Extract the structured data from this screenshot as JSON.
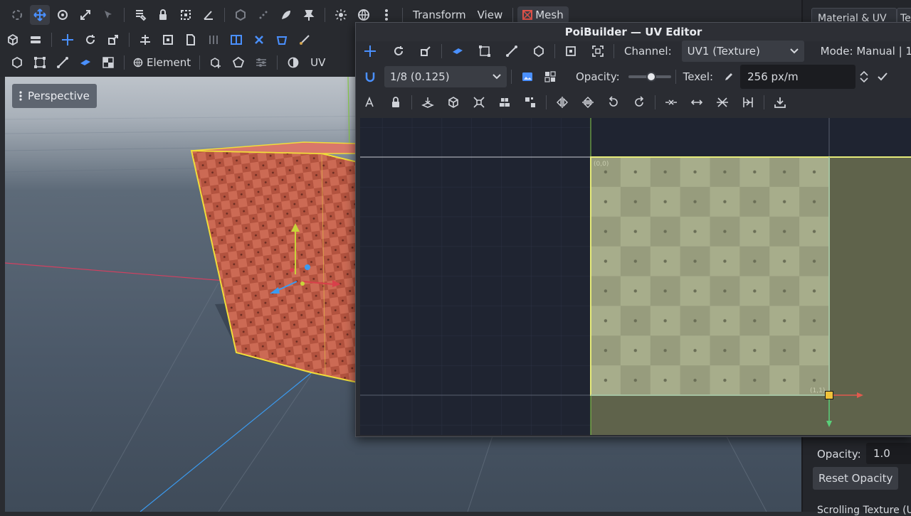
{
  "menus": {
    "transform": "Transform",
    "view": "View",
    "mesh": "Mesh"
  },
  "select_mode": {
    "element": "Element",
    "uv": "UV"
  },
  "viewport": {
    "perspective_label": "Perspective"
  },
  "right_panel": {
    "tabs": [
      "Material & UV",
      "Tex"
    ],
    "opacity_label": "Opacity:",
    "opacity_value": "1.0",
    "reset_opacity": "Reset Opacity",
    "scrolling_label": "Scrolling Texture (U"
  },
  "uv_editor": {
    "title": "PoiBuilder — UV Editor",
    "channel_label": "Channel:",
    "channel_value": "UV1 (Texture)",
    "mode_label": "Mode: Manual | 1",
    "grid_value": "1/8 (0.125)",
    "opacity_label": "Opacity:",
    "opacity_fraction": 0.55,
    "texel_label": "Texel:",
    "texel_value": "256 px/m",
    "corner_top_left": "(0,0)",
    "corner_bottom_right": "(1,1)"
  },
  "colors": {
    "accent": "#3c8cff",
    "uv_square": "#a8b08e",
    "uv_border": "#e6eb7a",
    "cube": "#c8624e",
    "handle": "#f0c23a"
  }
}
